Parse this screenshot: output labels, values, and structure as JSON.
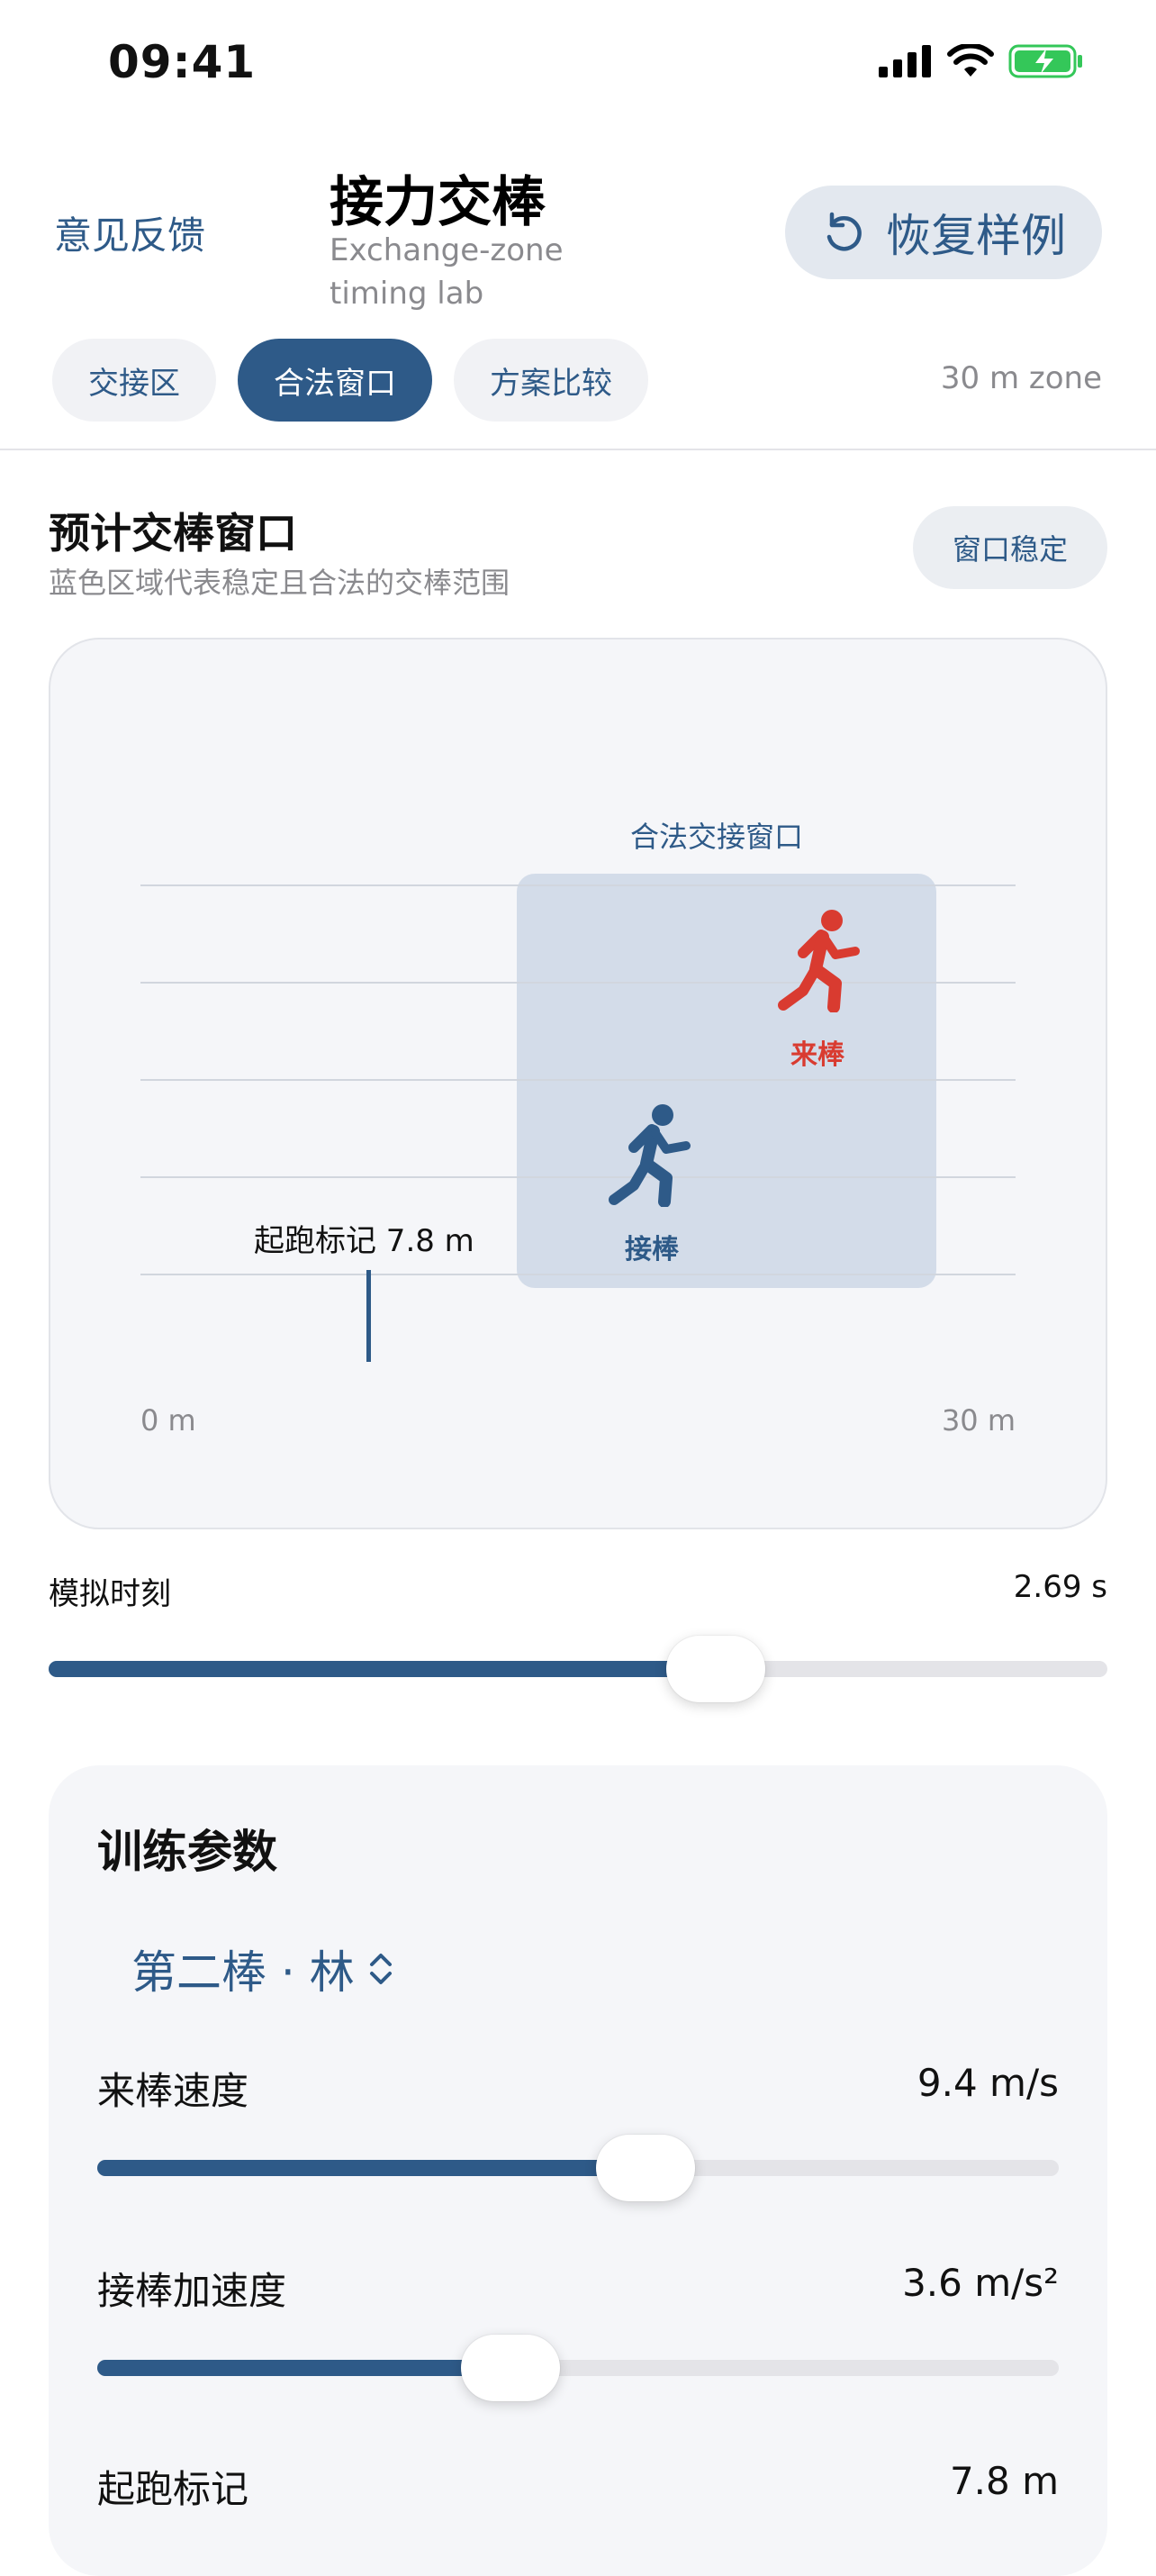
{
  "status_bar": {
    "time": "09:41"
  },
  "header": {
    "feedback": "意见反馈",
    "title": "接力交棒",
    "subtitle": "Exchange-zone timing lab",
    "reset": "恢复样例"
  },
  "tabs": [
    {
      "label": "交接区",
      "active": false
    },
    {
      "label": "合法窗口",
      "active": true
    },
    {
      "label": "方案比较",
      "active": false
    }
  ],
  "zone_label": "30 m zone",
  "section": {
    "title": "预计交棒窗口",
    "subtitle": "蓝色区域代表稳定且合法的交棒范围",
    "badge": "窗口稳定"
  },
  "chart": {
    "window_label": "合法交接窗口",
    "incoming_label": "来棒",
    "receiver_label": "接棒",
    "start_mark_label": "起跑标记 7.8 m",
    "axis_start": "0 m",
    "axis_end": "30 m",
    "colors": {
      "incoming": "#d93b30",
      "receiver": "#2e5a88"
    }
  },
  "sim": {
    "label": "模拟时刻",
    "value": "2.69 s",
    "progress": 0.63
  },
  "params": {
    "title": "训练参数",
    "runner": "第二棒 · 林",
    "items": [
      {
        "label": "来棒速度",
        "value": "9.4 m/s",
        "progress": 0.57
      },
      {
        "label": "接棒加速度",
        "value": "3.6 m/s²",
        "progress": 0.43
      },
      {
        "label": "起跑标记",
        "value": "7.8 m"
      }
    ]
  },
  "colors": {
    "accent": "#2e5a88",
    "incoming": "#d93b30"
  }
}
